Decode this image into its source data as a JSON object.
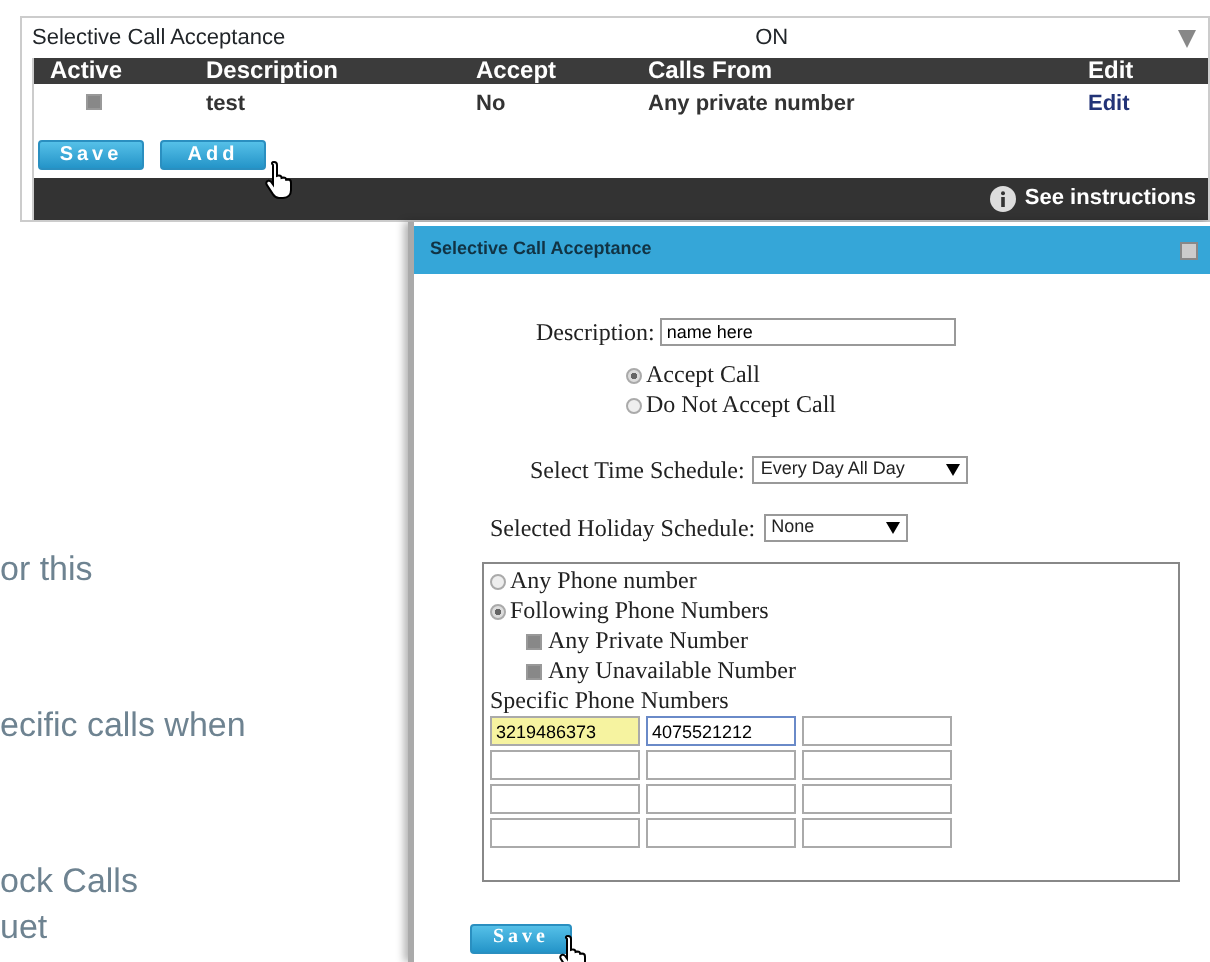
{
  "top_panel": {
    "title": "Selective Call Acceptance",
    "status": "ON",
    "columns": [
      "Active",
      "Description",
      "Accept",
      "Calls From",
      "Edit"
    ],
    "rows": [
      {
        "active": true,
        "description": "test",
        "accept": "No",
        "calls_from": "Any private number",
        "edit": "Edit"
      }
    ],
    "buttons": [
      "Save",
      "Add"
    ],
    "instructions_link": "See instructions"
  },
  "background_text": [
    "or this",
    "ecific calls when",
    "ock Calls",
    "uet"
  ],
  "dialog": {
    "title": "Selective Call Acceptance",
    "description": {
      "label": "Description:",
      "value": "name here"
    },
    "accept_options": [
      {
        "label": "Accept Call",
        "selected": true
      },
      {
        "label": "Do Not Accept Call",
        "selected": false
      }
    ],
    "time_schedule": {
      "label": "Select Time Schedule:",
      "value": "Every Day All Day"
    },
    "holiday_schedule": {
      "label": "Selected Holiday Schedule:",
      "value": "None"
    },
    "source_options": [
      {
        "label": "Any Phone number",
        "selected": false
      },
      {
        "label": "Following Phone Numbers",
        "selected": true
      }
    ],
    "filters": [
      {
        "label": "Any Private Number",
        "checked": true
      },
      {
        "label": "Any Unavailable Number",
        "checked": true
      }
    ],
    "specific_numbers": {
      "label": "Specific Phone Numbers",
      "values": [
        {
          "value": "3219486373",
          "highlighted": true,
          "focused": false
        },
        {
          "value": "4075521212",
          "highlighted": false,
          "focused": true
        }
      ]
    },
    "save_button": "Save"
  }
}
